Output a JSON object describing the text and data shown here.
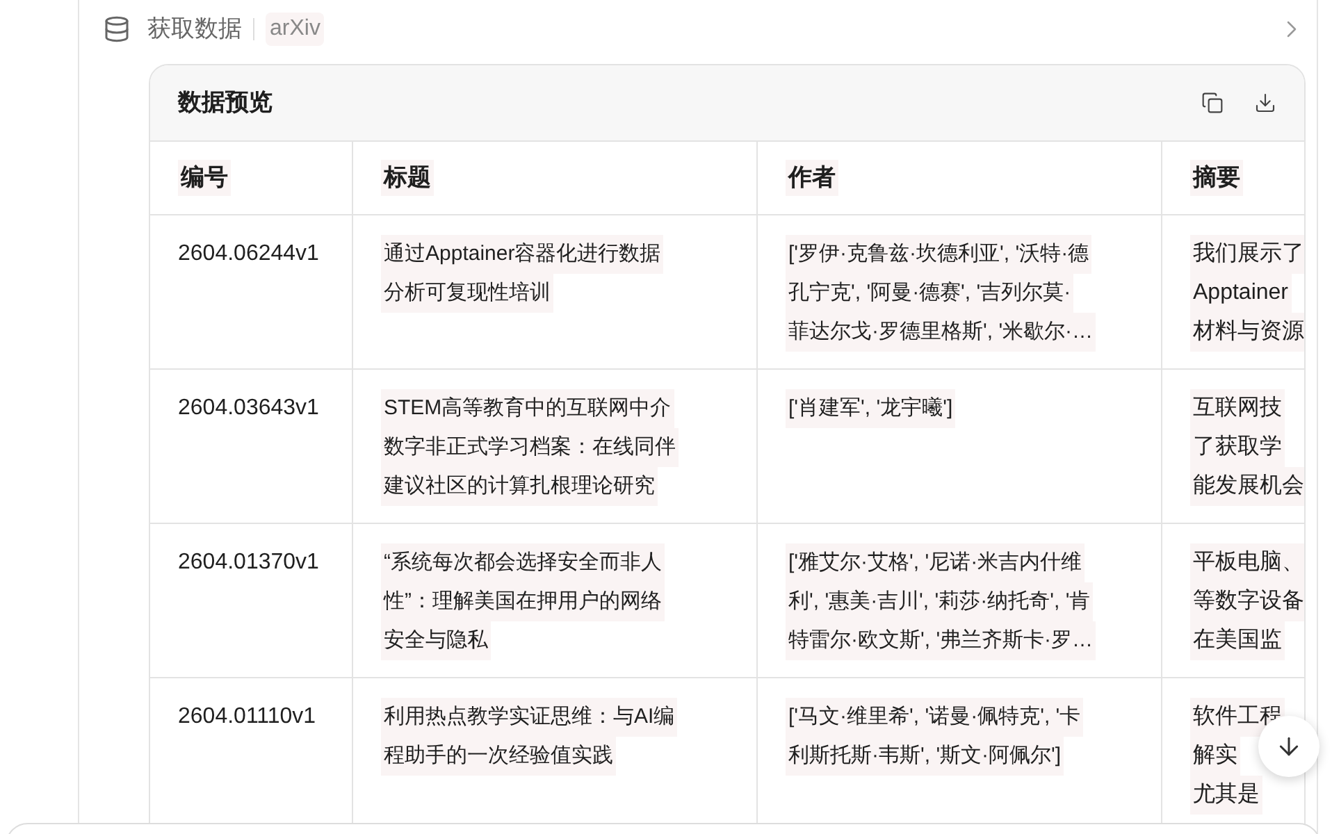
{
  "step": {
    "label": "获取数据",
    "source": "arXiv"
  },
  "preview": {
    "title": "数据预览",
    "columns": [
      "编号",
      "标题",
      "作者",
      "摘要"
    ],
    "rows": [
      {
        "id": "2604.06244v1",
        "title": [
          "通过Apptainer容器化进行数据",
          "分析可复现性培训"
        ],
        "authors": [
          "['罗伊·克鲁兹·坎德利亚', '沃特·德",
          "孔宁克', '阿曼·德赛', '吉列尔莫·",
          "菲达尔戈·罗德里格斯', '米歇尔·…"
        ],
        "abstract": [
          "我们展示了",
          "Apptainer",
          "材料与资源"
        ]
      },
      {
        "id": "2604.03643v1",
        "title": [
          "STEM高等教育中的互联网中介",
          "数字非正式学习档案：在线同伴",
          "建议社区的计算扎根理论研究"
        ],
        "authors": [
          "['肖建军', '龙宇曦']"
        ],
        "abstract": [
          "互联网技",
          "了获取学",
          "能发展机会"
        ]
      },
      {
        "id": "2604.01370v1",
        "title": [
          "“系统每次都会选择安全而非人",
          "性”：理解美国在押用户的网络",
          "安全与隐私"
        ],
        "authors": [
          "['雅艾尔·艾格', '尼诺·米吉内什维",
          "利', '惠美·吉川', '莉莎·纳托奇', '肯",
          "特雷尔·欧文斯', '弗兰齐斯卡·罗…"
        ],
        "abstract": [
          "平板电脑、",
          "等数字设备",
          "在美国监"
        ]
      },
      {
        "id": "2604.01110v1",
        "title": [
          "利用热点教学实证思维：与AI编",
          "程助手的一次经验值实践"
        ],
        "authors": [
          "['马文·维里希', '诺曼·佩特克', '卡",
          "利斯托斯·韦斯', '斯文·阿佩尔']"
        ],
        "abstract": [
          "软件工程",
          "解实",
          "尤其是"
        ]
      }
    ]
  }
}
